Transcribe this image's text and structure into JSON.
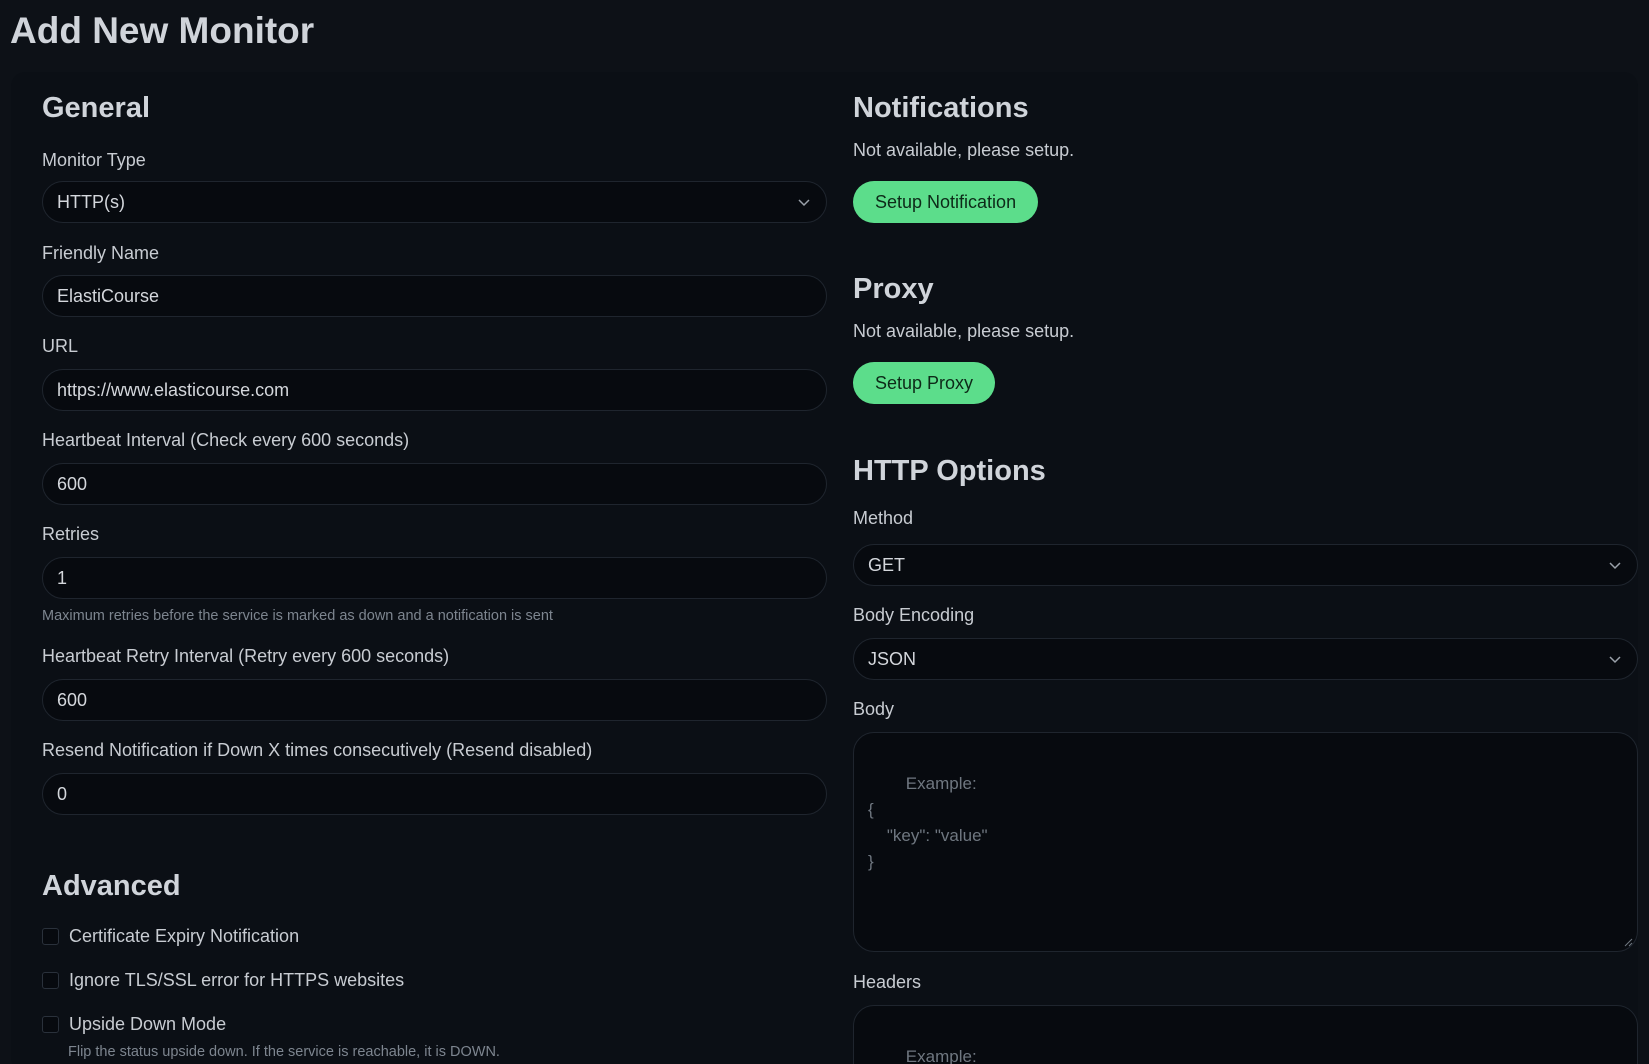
{
  "page": {
    "title": "Add New Monitor"
  },
  "general": {
    "heading": "General",
    "monitor_type": {
      "label": "Monitor Type",
      "value": "HTTP(s)"
    },
    "friendly_name": {
      "label": "Friendly Name",
      "value": "ElastiCourse"
    },
    "url": {
      "label": "URL",
      "value": "https://www.elasticourse.com"
    },
    "heartbeat_interval": {
      "label": "Heartbeat Interval (Check every 600 seconds)",
      "value": "600"
    },
    "retries": {
      "label": "Retries",
      "value": "1",
      "hint": "Maximum retries before the service is marked as down and a notification is sent"
    },
    "retry_interval": {
      "label": "Heartbeat Retry Interval (Retry every 600 seconds)",
      "value": "600"
    },
    "resend": {
      "label": "Resend Notification if Down X times consecutively (Resend disabled)",
      "value": "0"
    }
  },
  "advanced": {
    "heading": "Advanced",
    "cert_expiry": {
      "label": "Certificate Expiry Notification",
      "checked": false
    },
    "ignore_tls": {
      "label": "Ignore TLS/SSL error for HTTPS websites",
      "checked": false
    },
    "upside_down": {
      "label": "Upside Down Mode",
      "checked": false,
      "hint": "Flip the status upside down. If the service is reachable, it is DOWN."
    }
  },
  "notifications": {
    "heading": "Notifications",
    "status": "Not available, please setup.",
    "button": "Setup Notification"
  },
  "proxy": {
    "heading": "Proxy",
    "status": "Not available, please setup.",
    "button": "Setup Proxy"
  },
  "http_options": {
    "heading": "HTTP Options",
    "method": {
      "label": "Method",
      "value": "GET"
    },
    "body_encoding": {
      "label": "Body Encoding",
      "value": "JSON"
    },
    "body": {
      "label": "Body",
      "placeholder": "Example:\n{\n    \"key\": \"value\"\n}"
    },
    "headers": {
      "label": "Headers",
      "placeholder": "Example:\n{"
    }
  },
  "colors": {
    "accent": "#5cdd8b",
    "background": "#0d1117",
    "panel": "#0b0f15"
  }
}
